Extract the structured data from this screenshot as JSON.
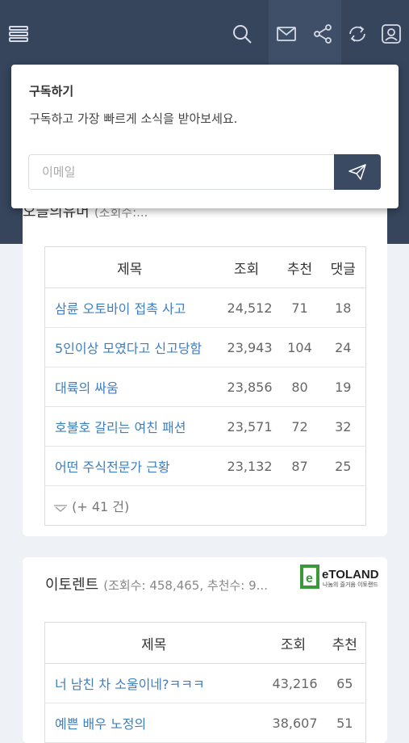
{
  "header": {
    "icons": [
      "menu-icon",
      "search-icon",
      "mail-icon",
      "share-icon",
      "refresh-icon",
      "profile-icon"
    ],
    "bg_color": "#36455c"
  },
  "subscribe": {
    "title": "구독하기",
    "description": "구독하고 가장 빠르게 소식을 받아보세요.",
    "email_placeholder": "이메일"
  },
  "card1": {
    "title": "오늘의유머",
    "subtitle": "(조회수:...",
    "headers": [
      "제목",
      "조회",
      "추천",
      "댓글"
    ],
    "rows": [
      {
        "title": "삼륜 오토바이 접촉 사고",
        "views": "24,512",
        "likes": "71",
        "comments": "18"
      },
      {
        "title": "5인이상 모였다고 신고당함",
        "views": "23,943",
        "likes": "104",
        "comments": "24"
      },
      {
        "title": "대륙의 싸움",
        "views": "23,856",
        "likes": "80",
        "comments": "19"
      },
      {
        "title": "호불호 갈리는 여친 패션",
        "views": "23,571",
        "likes": "72",
        "comments": "32"
      },
      {
        "title": "어떤 주식전문가 근황",
        "views": "23,132",
        "likes": "87",
        "comments": "25"
      }
    ],
    "more": "(+ 41 건)"
  },
  "card2": {
    "title": "이토렌트",
    "subtitle": "(조회수: 458,465, 추천수: 9...",
    "logo_text": "eTOLAND",
    "logo_sub": "나눔의 즐거움 이토랜드",
    "headers": [
      "제목",
      "조회",
      "추천"
    ],
    "rows": [
      {
        "title": "너 남친 차 소울이네?ㅋㅋㅋ",
        "views": "43,216",
        "likes": "65"
      },
      {
        "title": "예쁜 배우 노정의",
        "views": "38,607",
        "likes": "51"
      }
    ]
  }
}
